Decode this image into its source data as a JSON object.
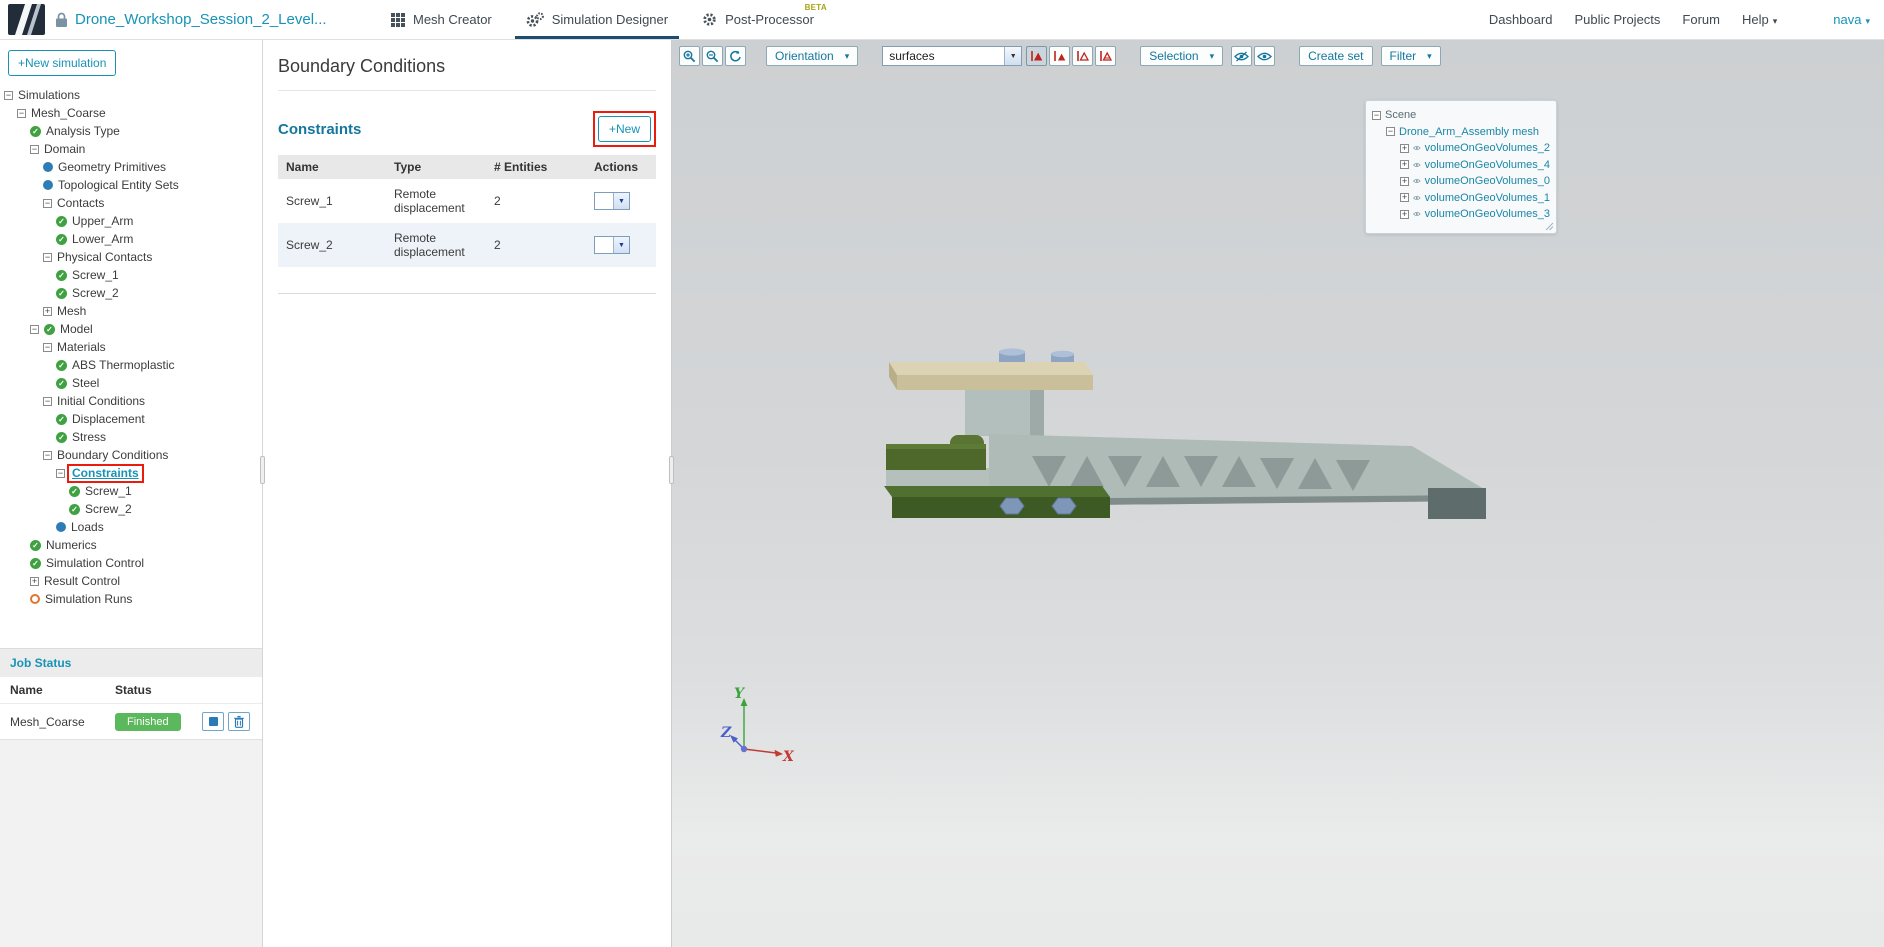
{
  "header": {
    "project_title": "Drone_Workshop_Session_2_Level...",
    "tabs": [
      {
        "label": "Mesh Creator",
        "icon": "grid-icon",
        "active": false
      },
      {
        "label": "Simulation Designer",
        "icon": "gears-icon",
        "active": true
      },
      {
        "label": "Post-Processor",
        "icon": "gear-icon",
        "active": false,
        "badge": "BETA"
      }
    ],
    "nav_links": [
      "Dashboard",
      "Public Projects",
      "Forum"
    ],
    "help_label": "Help",
    "user_label": "nava"
  },
  "sidebar": {
    "new_simulation_label": "+New simulation",
    "tree": [
      {
        "indent": 0,
        "toggle": "minus",
        "label": "Simulations"
      },
      {
        "indent": 1,
        "toggle": "minus",
        "label": "Mesh_Coarse"
      },
      {
        "indent": 2,
        "icon": "check",
        "label": "Analysis Type"
      },
      {
        "indent": 2,
        "toggle": "minus",
        "label": "Domain"
      },
      {
        "indent": 3,
        "icon": "dot",
        "label": "Geometry Primitives"
      },
      {
        "indent": 3,
        "icon": "dot",
        "label": "Topological Entity Sets"
      },
      {
        "indent": 3,
        "toggle": "minus",
        "label": "Contacts"
      },
      {
        "indent": 4,
        "icon": "check",
        "label": "Upper_Arm"
      },
      {
        "indent": 4,
        "icon": "check",
        "label": "Lower_Arm"
      },
      {
        "indent": 3,
        "toggle": "minus",
        "label": "Physical Contacts"
      },
      {
        "indent": 4,
        "icon": "check",
        "label": "Screw_1"
      },
      {
        "indent": 4,
        "icon": "check",
        "label": "Screw_2"
      },
      {
        "indent": 3,
        "toggle": "plus",
        "label": "Mesh"
      },
      {
        "indent": 2,
        "toggle": "minus",
        "icon": "check",
        "label": "Model"
      },
      {
        "indent": 3,
        "toggle": "minus",
        "label": "Materials"
      },
      {
        "indent": 4,
        "icon": "check",
        "label": "ABS Thermoplastic"
      },
      {
        "indent": 4,
        "icon": "check",
        "label": "Steel"
      },
      {
        "indent": 3,
        "toggle": "minus",
        "label": "Initial Conditions"
      },
      {
        "indent": 4,
        "icon": "check",
        "label": "Displacement"
      },
      {
        "indent": 4,
        "icon": "check",
        "label": "Stress"
      },
      {
        "indent": 3,
        "toggle": "minus",
        "label": "Boundary Conditions"
      },
      {
        "indent": 4,
        "toggle": "minus",
        "label": "Constraints",
        "highlight": true
      },
      {
        "indent": 5,
        "icon": "check",
        "label": "Screw_1"
      },
      {
        "indent": 5,
        "icon": "check",
        "label": "Screw_2"
      },
      {
        "indent": 4,
        "icon": "dot",
        "label": "Loads"
      },
      {
        "indent": 2,
        "icon": "check",
        "label": "Numerics"
      },
      {
        "indent": 2,
        "icon": "check",
        "label": "Simulation Control"
      },
      {
        "indent": 2,
        "toggle": "plus",
        "label": "Result Control"
      },
      {
        "indent": 2,
        "icon": "circle",
        "label": "Simulation Runs"
      }
    ],
    "job_status": {
      "title": "Job Status",
      "columns": [
        "Name",
        "Status"
      ],
      "rows": [
        {
          "name": "Mesh_Coarse",
          "status": "Finished"
        }
      ]
    }
  },
  "panel": {
    "title": "Boundary Conditions",
    "section": "Constraints",
    "new_button_label": "+New",
    "table": {
      "columns": [
        "Name",
        "Type",
        "# Entities",
        "Actions"
      ],
      "rows": [
        {
          "name": "Screw_1",
          "type": "Remote displacement",
          "entities": "2"
        },
        {
          "name": "Screw_2",
          "type": "Remote displacement",
          "entities": "2"
        }
      ]
    }
  },
  "viewport": {
    "toolbar": {
      "orientation_label": "Orientation",
      "display_mode_value": "surfaces",
      "selection_label": "Selection",
      "create_set_label": "Create set",
      "filter_label": "Filter"
    },
    "scene_tree": {
      "root": "Scene",
      "mesh_label": "Drone_Arm_Assembly mesh",
      "volumes": [
        "volumeOnGeoVolumes_2",
        "volumeOnGeoVolumes_4",
        "volumeOnGeoVolumes_0",
        "volumeOnGeoVolumes_1",
        "volumeOnGeoVolumes_3"
      ]
    },
    "axes": {
      "x": "X",
      "y": "Y",
      "z": "Z"
    }
  },
  "icons": {
    "caret_down": "▾",
    "select_arrow": "▼",
    "collapse": "−",
    "expand": "+",
    "check": "✓"
  },
  "colors": {
    "accent_teal": "#1693b6",
    "heading_teal": "#15779e",
    "tab_underline": "#1d4e70",
    "annotation_red": "#ea1c0d",
    "status_finished_green": "#5cb85c",
    "tree_check_green": "#3fa142",
    "tree_dot_blue": "#2e7cb5",
    "tree_pending_orange": "#e0762f"
  }
}
